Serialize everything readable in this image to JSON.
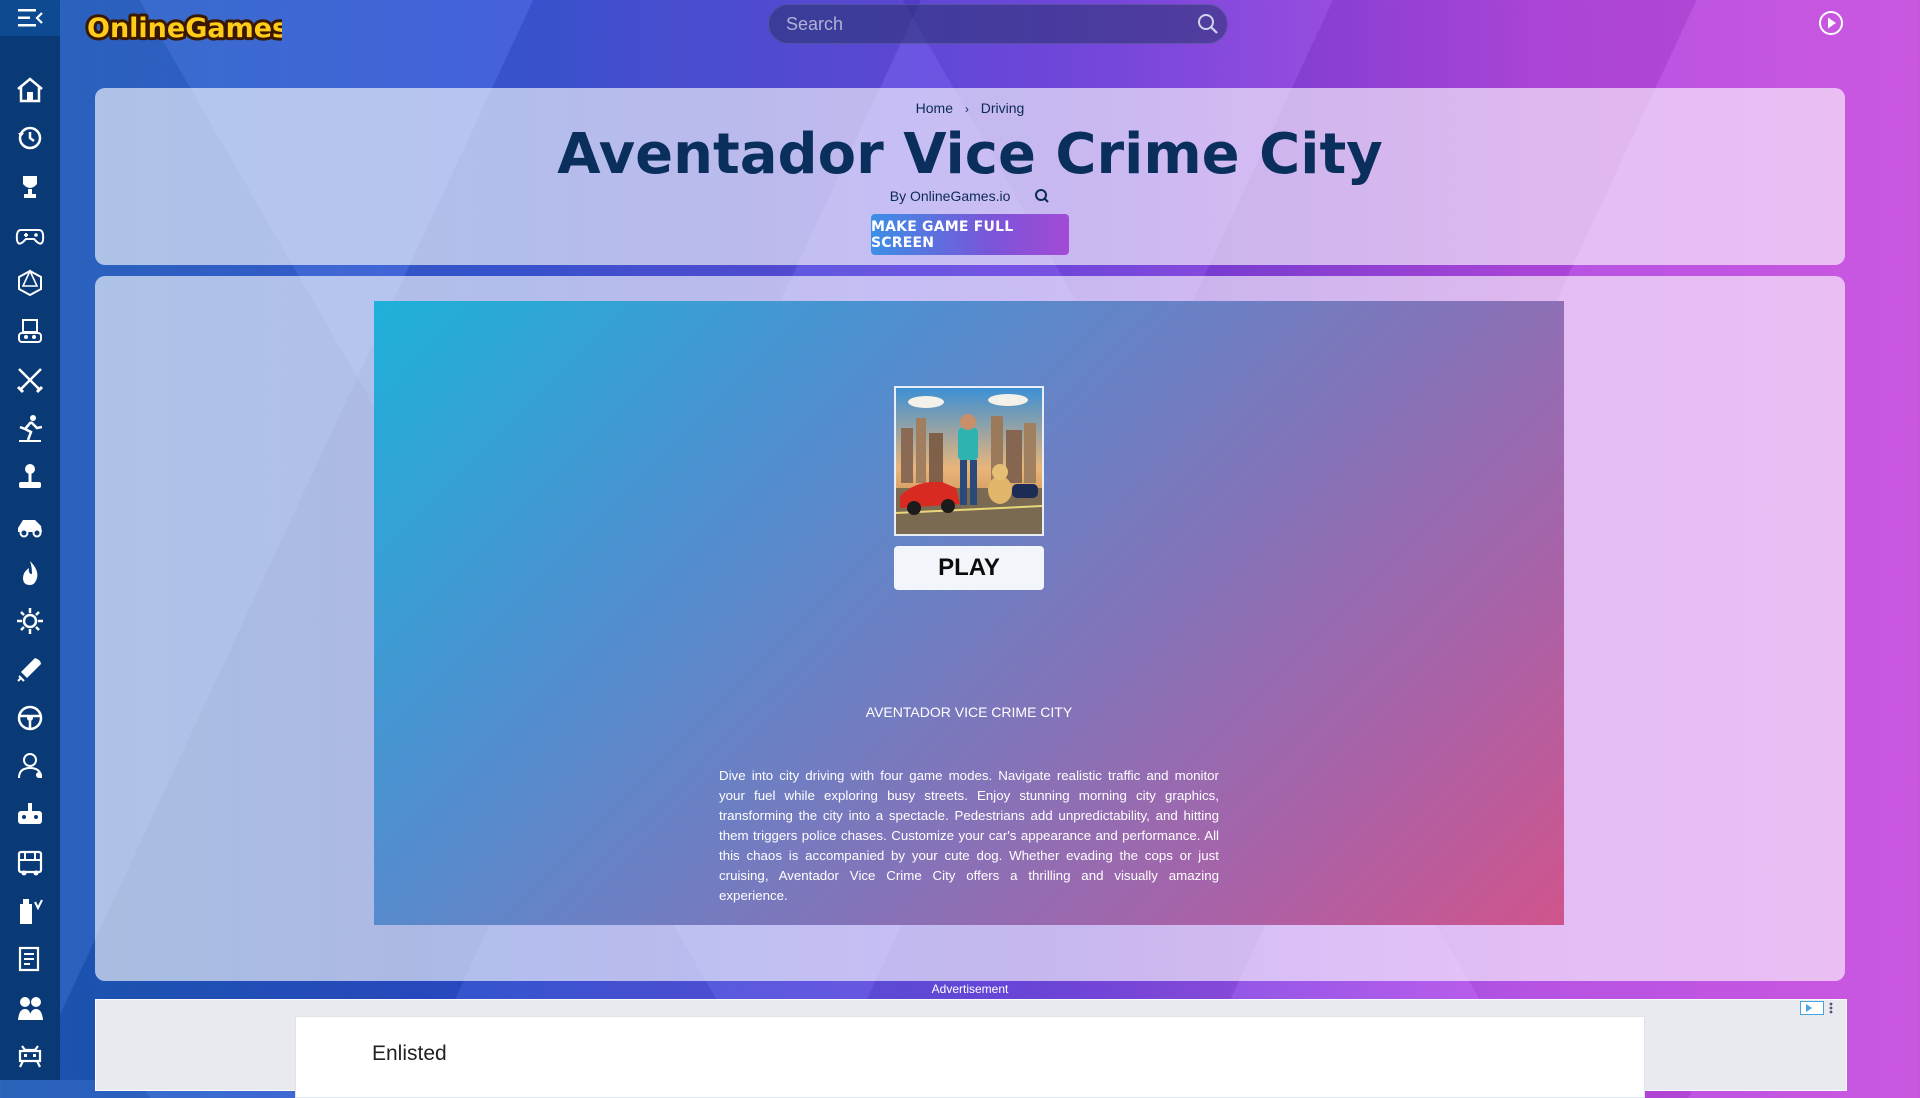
{
  "site": {
    "logo_text": "OnlineGames.io"
  },
  "search": {
    "placeholder": "Search"
  },
  "sidebar": {
    "items": [
      {
        "icon": "home-icon"
      },
      {
        "icon": "history-icon"
      },
      {
        "icon": "trophy-icon"
      },
      {
        "icon": "gamepad-icon"
      },
      {
        "icon": "d20-dice-icon"
      },
      {
        "icon": "robot-cube-icon"
      },
      {
        "icon": "crossed-swords-icon"
      },
      {
        "icon": "runner-icon"
      },
      {
        "icon": "joystick-icon"
      },
      {
        "icon": "car-racing-icon"
      },
      {
        "icon": "fire-icon"
      },
      {
        "icon": "gear-icon"
      },
      {
        "icon": "rocket-icon"
      },
      {
        "icon": "steering-wheel-icon"
      },
      {
        "icon": "character-icon"
      },
      {
        "icon": "controller-icon"
      },
      {
        "icon": "bus-icon"
      },
      {
        "icon": "building-icon"
      },
      {
        "icon": "map-icon"
      },
      {
        "icon": "couple-icon"
      },
      {
        "icon": "space-invader-icon"
      }
    ]
  },
  "breadcrumb": {
    "home": "Home",
    "separator": "›",
    "category": "Driving"
  },
  "game": {
    "title": "Aventador Vice Crime City",
    "byline": "By OnlineGames.io",
    "fullscreen_label": "MAKE GAME FULL SCREEN",
    "play_label": "PLAY",
    "name_caps": "AVENTADOR VICE CRIME CITY",
    "description": "Dive into city driving with four game modes. Navigate realistic traffic and monitor your fuel while exploring busy streets. Enjoy stunning morning city graphics, transforming the city into a spectacle. Pedestrians add unpredictability, and hitting them triggers police chases. Customize your car's appearance and performance. All this chaos is accompanied by your cute dog. Whether evading the cops or just cruising, Aventador Vice Crime City offers a thrilling and visually amazing experience."
  },
  "ad": {
    "label": "Advertisement",
    "text": "Enlisted"
  },
  "colors": {
    "sidebar": "#0a3a76",
    "title": "#0a2f5c",
    "button_start": "#3c8fe6",
    "button_end": "#a24ad6"
  }
}
